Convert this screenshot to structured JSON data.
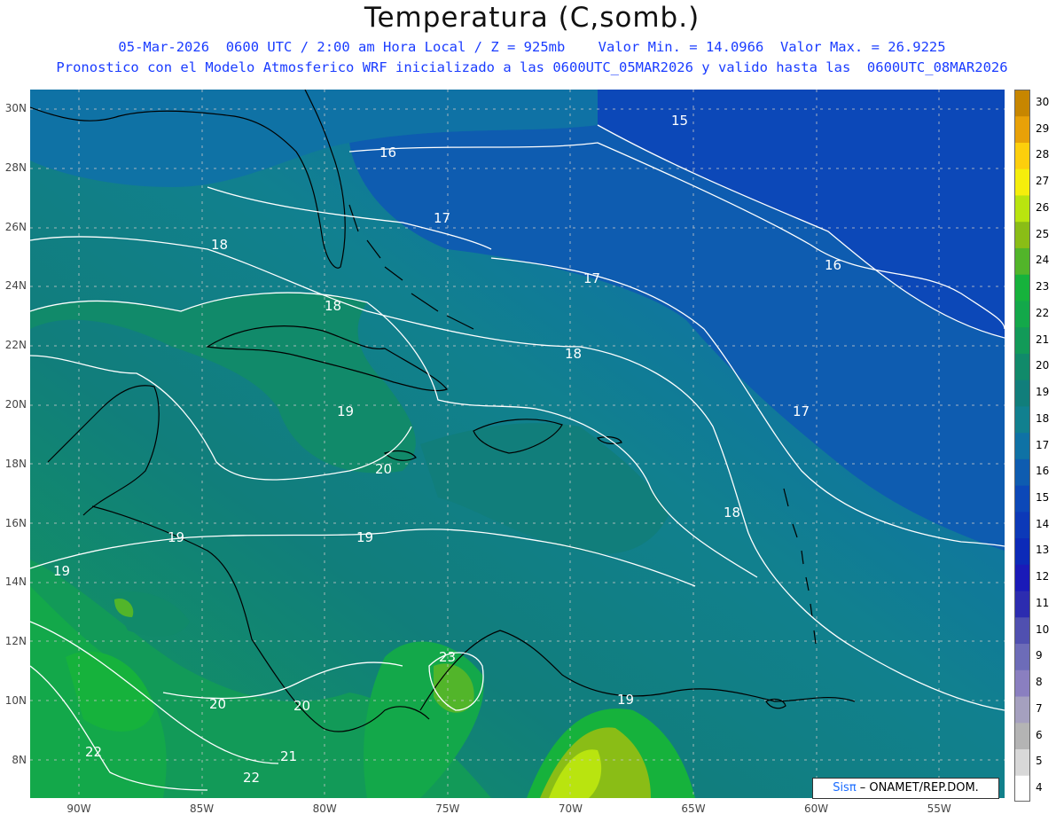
{
  "title": "Temperatura (C,somb.)",
  "subtitle_line1": "05-Mar-2026  0600 UTC / 2:00 am Hora Local / Z = 925mb    Valor Min. = 14.0966  Valor Max. = 26.9225",
  "subtitle_line2": "Pronostico con el Modelo Atmosferico WRF inicializado a las 0600UTC_05MAR2026 y valido hasta las  0600UTC_08MAR2026",
  "colorbar": {
    "levels": [
      "4",
      "5",
      "6",
      "7",
      "8",
      "9",
      "10",
      "11",
      "12",
      "13",
      "14",
      "15",
      "16",
      "17",
      "18",
      "19",
      "20",
      "21",
      "22",
      "23",
      "24",
      "25",
      "26",
      "27",
      "28",
      "29",
      "30"
    ],
    "colors": [
      "#ffffff",
      "#d8d8d8",
      "#b4b4b4",
      "#a5a0bf",
      "#8a7fc0",
      "#6d6cb8",
      "#5050b0",
      "#2c2cb0",
      "#1a1ab8",
      "#0c2ab8",
      "#0c39b8",
      "#0c48b8",
      "#0e5cb0",
      "#0f72a5",
      "#11808f",
      "#117e7b",
      "#118a6a",
      "#129a58",
      "#13a84a",
      "#16b23c",
      "#52b52a",
      "#8abd16",
      "#b9e40f",
      "#f5ee0c",
      "#fdcf0c",
      "#e8a108",
      "#c78600"
    ]
  },
  "lat_labels": [
    "30N",
    "28N",
    "26N",
    "24N",
    "22N",
    "20N",
    "18N",
    "16N",
    "14N",
    "12N",
    "10N",
    "8N"
  ],
  "lon_labels": [
    "90W",
    "85W",
    "80W",
    "75W",
    "70W",
    "65W",
    "60W",
    "55W"
  ],
  "contour_labels": [
    "15",
    "16",
    "16",
    "17",
    "17",
    "17",
    "18",
    "18",
    "18",
    "18",
    "19",
    "19",
    "19",
    "19",
    "19",
    "20",
    "20",
    "20",
    "21",
    "22",
    "22",
    "23"
  ],
  "credit": {
    "brand": "Sisπ",
    "text": " – ONAMET/REP.DOM."
  }
}
